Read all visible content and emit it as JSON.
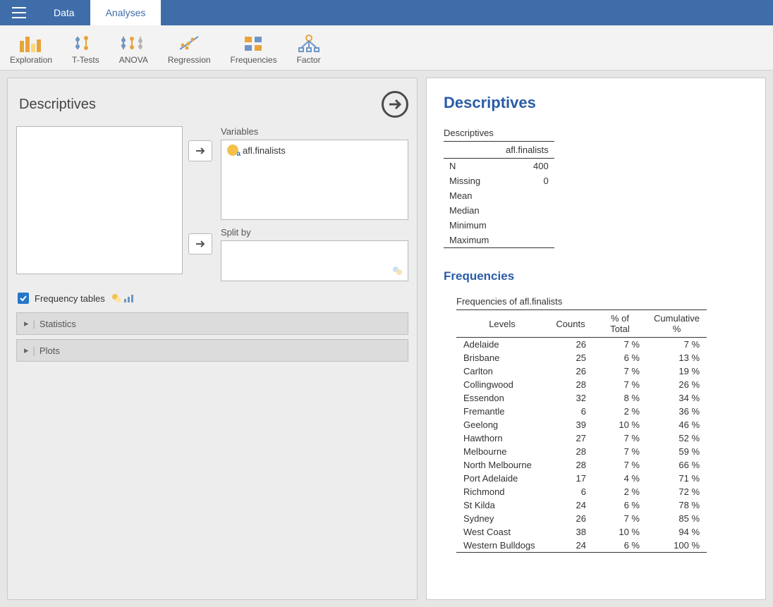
{
  "tabs": {
    "data": "Data",
    "analyses": "Analyses"
  },
  "ribbon": {
    "exploration": "Exploration",
    "ttests": "T-Tests",
    "anova": "ANOVA",
    "regression": "Regression",
    "frequencies": "Frequencies",
    "factor": "Factor"
  },
  "leftPanel": {
    "title": "Descriptives",
    "variablesLabel": "Variables",
    "splitByLabel": "Split by",
    "variable1": "afl.finalists",
    "freqTablesLabel": "Frequency tables",
    "statisticsLabel": "Statistics",
    "plotsLabel": "Plots"
  },
  "results": {
    "heading": "Descriptives",
    "descTitle": "Descriptives",
    "colHeader": "afl.finalists",
    "rows": {
      "n": {
        "label": "N",
        "value": "400"
      },
      "missing": {
        "label": "Missing",
        "value": "0"
      },
      "mean": {
        "label": "Mean",
        "value": ""
      },
      "median": {
        "label": "Median",
        "value": ""
      },
      "minimum": {
        "label": "Minimum",
        "value": ""
      },
      "maximum": {
        "label": "Maximum",
        "value": ""
      }
    },
    "freqHeading": "Frequencies",
    "freqTitle": "Frequencies of afl.finalists",
    "freqHeaders": {
      "levels": "Levels",
      "counts": "Counts",
      "pct": "% of Total",
      "cum": "Cumulative %"
    },
    "freqRows": [
      {
        "level": "Adelaide",
        "count": "26",
        "pct": "7 %",
        "cum": "7 %"
      },
      {
        "level": "Brisbane",
        "count": "25",
        "pct": "6 %",
        "cum": "13 %"
      },
      {
        "level": "Carlton",
        "count": "26",
        "pct": "7 %",
        "cum": "19 %"
      },
      {
        "level": "Collingwood",
        "count": "28",
        "pct": "7 %",
        "cum": "26 %"
      },
      {
        "level": "Essendon",
        "count": "32",
        "pct": "8 %",
        "cum": "34 %"
      },
      {
        "level": "Fremantle",
        "count": "6",
        "pct": "2 %",
        "cum": "36 %"
      },
      {
        "level": "Geelong",
        "count": "39",
        "pct": "10 %",
        "cum": "46 %"
      },
      {
        "level": "Hawthorn",
        "count": "27",
        "pct": "7 %",
        "cum": "52 %"
      },
      {
        "level": "Melbourne",
        "count": "28",
        "pct": "7 %",
        "cum": "59 %"
      },
      {
        "level": "North Melbourne",
        "count": "28",
        "pct": "7 %",
        "cum": "66 %"
      },
      {
        "level": "Port Adelaide",
        "count": "17",
        "pct": "4 %",
        "cum": "71 %"
      },
      {
        "level": "Richmond",
        "count": "6",
        "pct": "2 %",
        "cum": "72 %"
      },
      {
        "level": "St Kilda",
        "count": "24",
        "pct": "6 %",
        "cum": "78 %"
      },
      {
        "level": "Sydney",
        "count": "26",
        "pct": "7 %",
        "cum": "85 %"
      },
      {
        "level": "West Coast",
        "count": "38",
        "pct": "10 %",
        "cum": "94 %"
      },
      {
        "level": "Western Bulldogs",
        "count": "24",
        "pct": "6 %",
        "cum": "100 %"
      }
    ]
  }
}
